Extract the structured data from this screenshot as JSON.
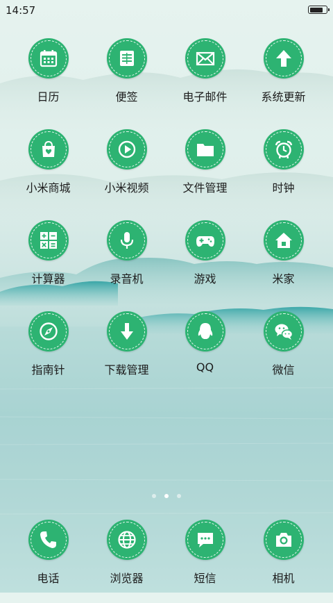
{
  "status_bar": {
    "time": "14:57",
    "battery_level": 0.85
  },
  "apps": [
    [
      {
        "label": "日历",
        "icon": "calendar-icon"
      },
      {
        "label": "便签",
        "icon": "notes-icon"
      },
      {
        "label": "电子邮件",
        "icon": "mail-icon"
      },
      {
        "label": "系统更新",
        "icon": "update-icon"
      }
    ],
    [
      {
        "label": "小米商城",
        "icon": "shop-icon"
      },
      {
        "label": "小米视频",
        "icon": "video-icon"
      },
      {
        "label": "文件管理",
        "icon": "folder-icon"
      },
      {
        "label": "时钟",
        "icon": "clock-icon"
      }
    ],
    [
      {
        "label": "计算器",
        "icon": "calculator-icon"
      },
      {
        "label": "录音机",
        "icon": "microphone-icon"
      },
      {
        "label": "游戏",
        "icon": "gamepad-icon"
      },
      {
        "label": "米家",
        "icon": "home-icon"
      }
    ],
    [
      {
        "label": "指南针",
        "icon": "compass-icon"
      },
      {
        "label": "下载管理",
        "icon": "download-icon"
      },
      {
        "label": "QQ",
        "icon": "qq-icon"
      },
      {
        "label": "微信",
        "icon": "wechat-icon"
      }
    ]
  ],
  "dock": [
    {
      "label": "电话",
      "icon": "phone-icon"
    },
    {
      "label": "浏览器",
      "icon": "browser-icon"
    },
    {
      "label": "短信",
      "icon": "message-icon"
    },
    {
      "label": "相机",
      "icon": "camera-icon"
    }
  ],
  "pager": {
    "pages": 3,
    "active": 1
  },
  "colors": {
    "icon_bg": "#2db372",
    "label": "#1c1c1c"
  }
}
